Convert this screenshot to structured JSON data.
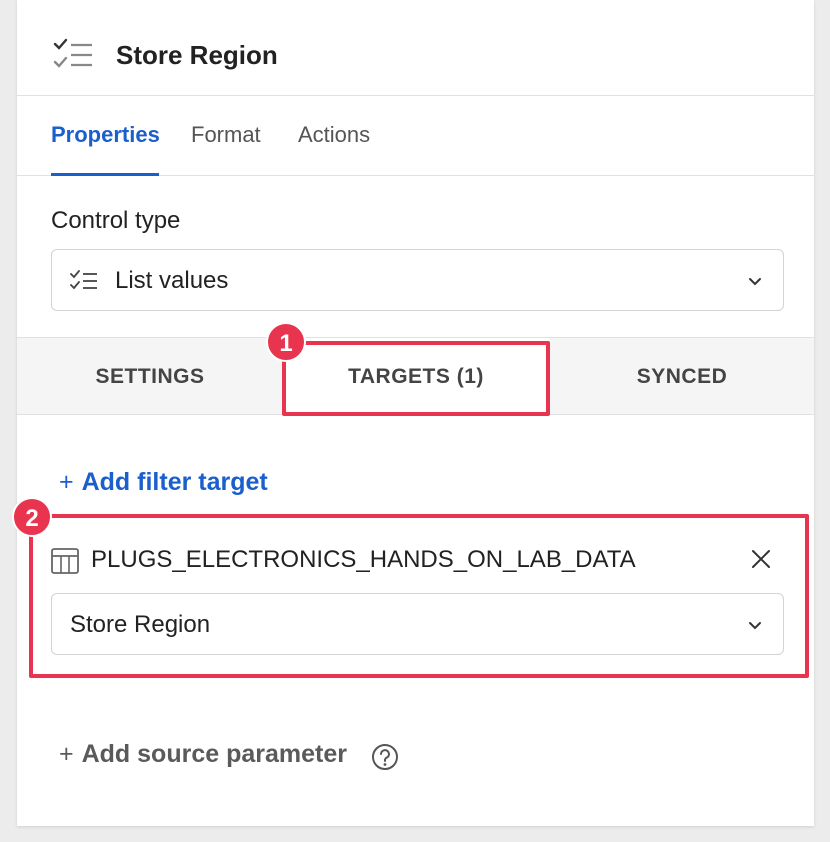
{
  "header": {
    "title": "Store Region",
    "icon": "list-check-icon"
  },
  "tabs": [
    {
      "label": "Properties",
      "active": true
    },
    {
      "label": "Format",
      "active": false
    },
    {
      "label": "Actions",
      "active": false
    }
  ],
  "control_type": {
    "label": "Control type",
    "value": "List values",
    "icon": "list-check-icon"
  },
  "subtabs": [
    {
      "label": "SETTINGS",
      "active": false
    },
    {
      "label": "TARGETS (1)",
      "active": true
    },
    {
      "label": "SYNCED",
      "active": false
    }
  ],
  "add_filter_target": {
    "plus": "+",
    "label": "Add filter target"
  },
  "target": {
    "source": "PLUGS_ELECTRONICS_HANDS_ON_LAB_DATA",
    "column": "Store Region"
  },
  "add_source_parameter": {
    "plus": "+",
    "label": "Add source parameter"
  },
  "annotations": {
    "badge_1": "1",
    "badge_2": "2"
  },
  "colors": {
    "accent": "#1a5fcc",
    "annotation": "#e8344e"
  }
}
